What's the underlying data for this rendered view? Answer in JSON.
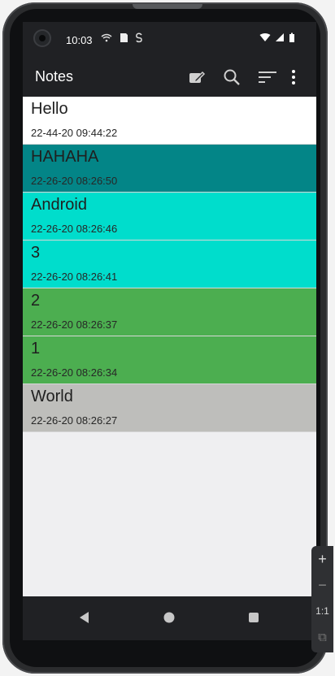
{
  "status_bar": {
    "time": "10:03",
    "icons": [
      "camera-icon",
      "wifi-icon",
      "battery-icon"
    ]
  },
  "app_bar": {
    "title": "Notes",
    "actions": [
      "new-note-icon",
      "search-icon",
      "sort-icon",
      "more-icon"
    ]
  },
  "notes": [
    {
      "title": "Hello",
      "time": "22-44-20 09:44:22",
      "color": "#ffffff"
    },
    {
      "title": "HAHAHA",
      "time": "22-26-20 08:26:50",
      "color": "#038587"
    },
    {
      "title": "Android",
      "time": "22-26-20 08:26:46",
      "color": "#00ddcc"
    },
    {
      "title": "3",
      "time": "22-26-20 08:26:41",
      "color": "#00ddcc"
    },
    {
      "title": "2",
      "time": "22-26-20 08:26:37",
      "color": "#4cae50"
    },
    {
      "title": "1",
      "time": "22-26-20 08:26:34",
      "color": "#4cae50"
    },
    {
      "title": "World",
      "time": "22-26-20 08:26:27",
      "color": "#bebebb"
    }
  ],
  "side_tools": {
    "zoom_in": "+",
    "zoom_out": "−",
    "fit": "1:1",
    "screen": "⧉"
  }
}
